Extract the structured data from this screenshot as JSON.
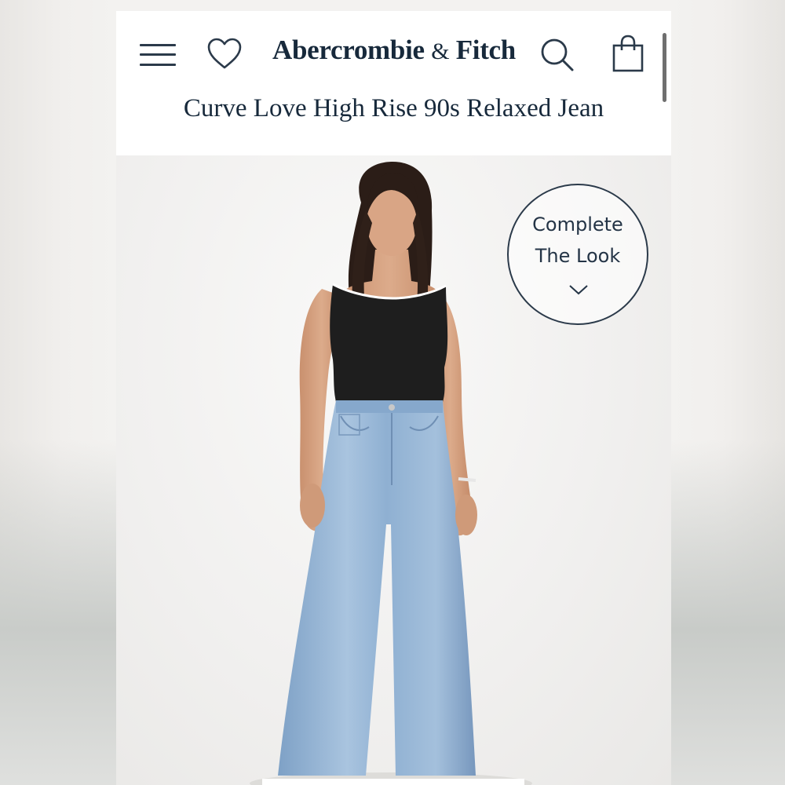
{
  "header": {
    "brand_main": "Abercrombie",
    "brand_amp": "&",
    "brand_end": "Fitch",
    "menu_icon": "hamburger-menu-icon",
    "wishlist_icon": "heart-icon",
    "search_icon": "search-icon",
    "bag_icon": "shopping-bag-icon"
  },
  "product": {
    "title": "Curve Love High Rise 90s Relaxed Jean"
  },
  "complete_look": {
    "line1": "Complete",
    "line2": "The Look",
    "icon": "chevron-down-icon"
  },
  "colors": {
    "brand_navy": "#17293b",
    "header_bg": "#ffffff",
    "hero_bg": "#f2f1ef",
    "denim": "#8fb2d4",
    "top": "#1c1c1c"
  }
}
